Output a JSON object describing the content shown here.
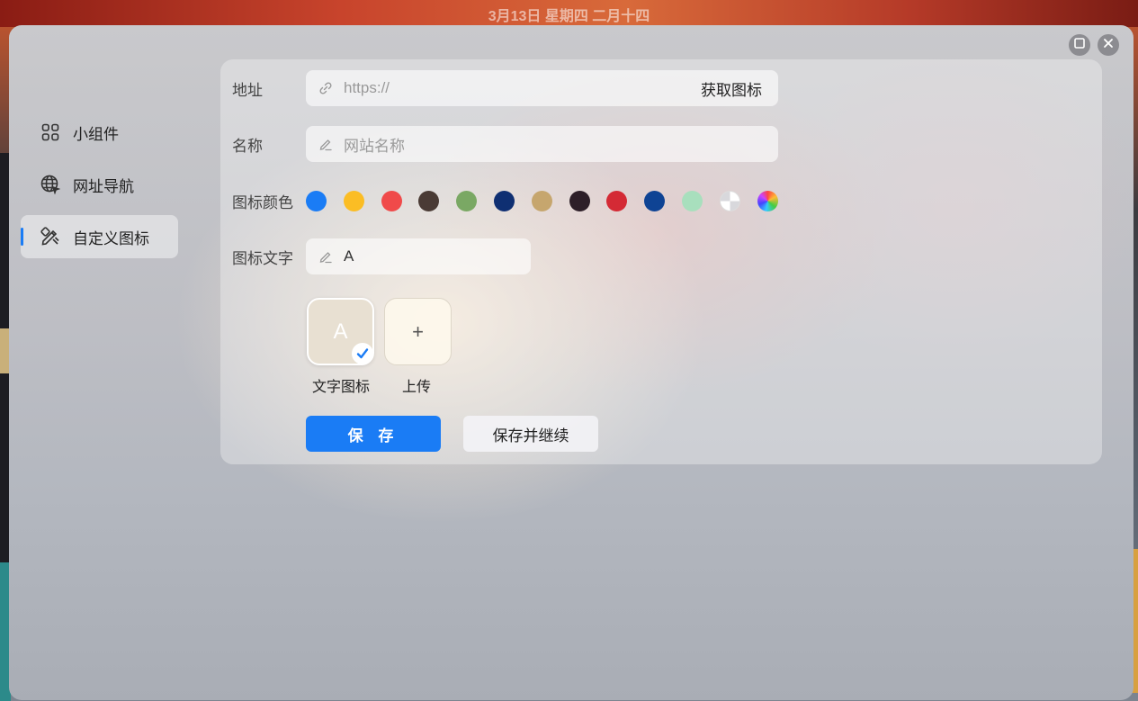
{
  "background": {
    "date_text": "3月13日 星期四 二月十四"
  },
  "sidebar": {
    "items": [
      {
        "label": "小组件",
        "icon": "grid-icon",
        "active": false
      },
      {
        "label": "网址导航",
        "icon": "globe-icon",
        "active": false
      },
      {
        "label": "自定义图标",
        "icon": "design-tools-icon",
        "active": true
      }
    ]
  },
  "form": {
    "address": {
      "label": "地址",
      "placeholder": "https://",
      "fetch_label": "获取图标"
    },
    "name": {
      "label": "名称",
      "placeholder": "网站名称"
    },
    "icon_color": {
      "label": "图标颜色",
      "colors": [
        "#1a7cf5",
        "#fbbd24",
        "#f04a4a",
        "#4a3b35",
        "#7aa864",
        "#0f2f72",
        "#c6a66e",
        "#2d1f28",
        "#d42a35",
        "#0e4394",
        "#a8dfbd",
        "transparent",
        "rainbow"
      ]
    },
    "icon_text": {
      "label": "图标文字",
      "value": "A"
    },
    "icon_options": [
      {
        "preview": "A",
        "caption": "文字图标",
        "selected": true
      },
      {
        "preview": "+",
        "caption": "上传",
        "selected": false
      }
    ],
    "save_label": "保 存",
    "save_continue_label": "保存并继续"
  },
  "window_controls": [
    "maximize-icon",
    "close-icon"
  ]
}
